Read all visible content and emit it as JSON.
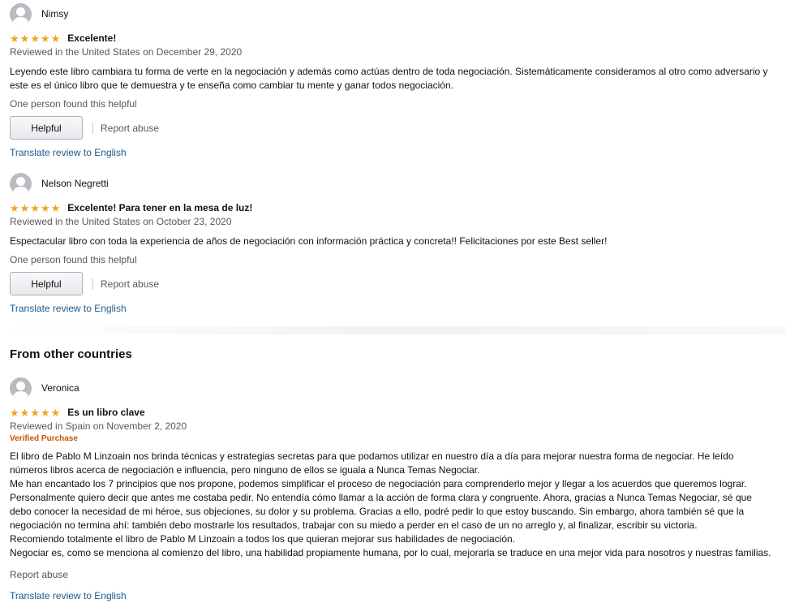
{
  "reviews": [
    {
      "name": "Nimsy",
      "rating": 5,
      "title": "Excelente!",
      "date": "Reviewed in the United States on December 29, 2020",
      "body": [
        "Leyendo este libro cambiara tu forma de verte en la negociación y además como actúas dentro de toda negociación. Sistemáticamente consideramos al otro como adversario y este es el único libro que te demuestra y te enseña como cambiar tu mente y ganar todos negociación."
      ],
      "helpful_count": "One person found this helpful",
      "helpful_button": "Helpful",
      "report": "Report abuse",
      "translate": "Translate review to English"
    },
    {
      "name": "Nelson Negretti",
      "rating": 5,
      "title": "Excelente! Para tener en la mesa de luz!",
      "date": "Reviewed in the United States on October 23, 2020",
      "body": [
        "Espectacular libro con toda la experiencia de años de negociación con información práctica y concreta!! Felicitaciones por este Best seller!"
      ],
      "helpful_count": "One person found this helpful",
      "helpful_button": "Helpful",
      "report": "Report abuse",
      "translate": "Translate review to English"
    }
  ],
  "other_countries": {
    "heading": "From other countries",
    "review": {
      "name": "Veronica",
      "rating": 5,
      "title": "Es un libro clave",
      "date": "Reviewed in Spain on November 2, 2020",
      "verified": "Verified Purchase",
      "body": [
        "El libro de Pablo M Linzoain nos brinda técnicas y estrategias secretas para que podamos utilizar en nuestro día a día para mejorar nuestra forma de negociar. He leído números libros acerca de negociación e influencia, pero ninguno de ellos se iguala a Nunca Temas Negociar.",
        "Me han encantado los 7 principios que nos propone, podemos simplificar el proceso de negociación para comprenderlo mejor y llegar a los acuerdos que queremos lograr.",
        "Personalmente quiero decir que antes me costaba pedir. No entendía cómo llamar a la acción de forma clara y congruente. Ahora, gracias a Nunca Temas Negociar, sé que debo conocer la necesidad de mi héroe, sus objeciones, su dolor y su problema. Gracias a ello, podré pedir lo que estoy buscando. Sin embargo, ahora también sé que la negociación no termina ahí: también debo mostrarle los resultados, trabajar con su miedo a perder en el caso de un no arreglo y, al finalizar, escribir su victoria.",
        "Recomiendo totalmente el libro de Pablo M Linzoain a todos los que quieran mejorar sus habilidades de negociación.",
        "Negociar es, como se menciona al comienzo del libro, una habilidad propiamente humana, por lo cual, mejorarla se traduce en una mejor vida para nosotros y nuestras familias."
      ],
      "report": "Report abuse",
      "translate": "Translate review to English"
    }
  },
  "colors": {
    "star": "#f0a41c",
    "link": "#1c5a8c",
    "verified": "#c45500",
    "muted": "#565959"
  },
  "icons": {
    "avatar": "default-avatar-icon",
    "star": "star-icon"
  }
}
